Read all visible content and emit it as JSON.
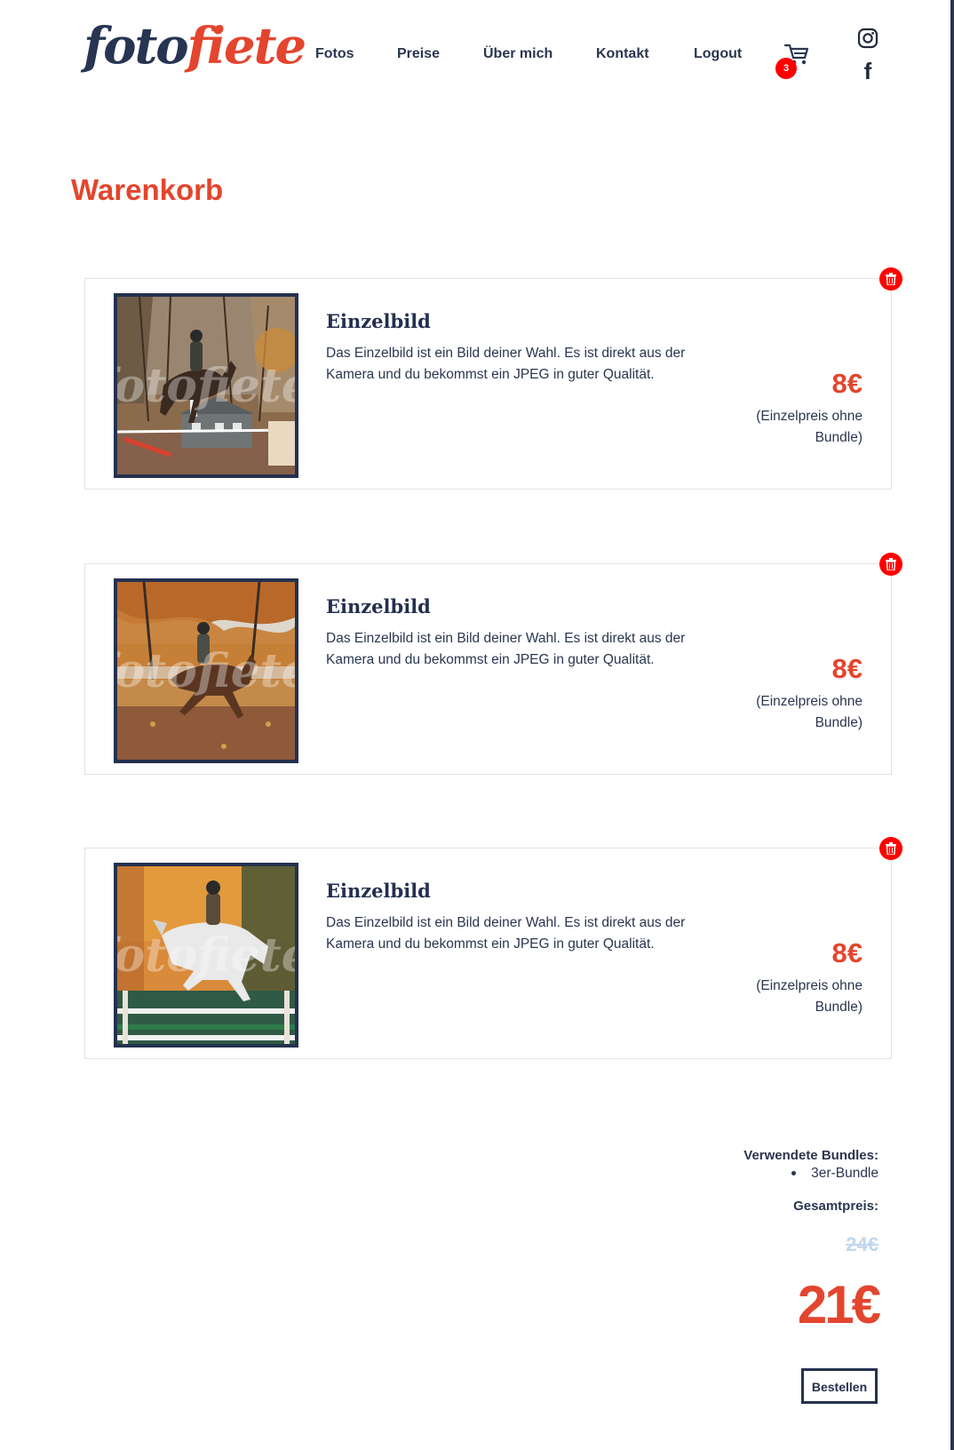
{
  "header": {
    "logo": {
      "part1": "foto",
      "part2": "fiete"
    },
    "nav": [
      "Fotos",
      "Preise",
      "Über mich",
      "Kontakt",
      "Logout"
    ],
    "cart_count": "3",
    "cart_icon": "shopping-cart-icon",
    "social": [
      "instagram-icon",
      "facebook-icon"
    ],
    "facebook_glyph": "f"
  },
  "page_title": "Warenkorb",
  "items": [
    {
      "title": "Einzelbild",
      "description": "Das Einzelbild ist ein Bild deiner Wahl. Es ist direkt aus der Kamera und du bekommst ein JPEG in guter Qualität.",
      "price": "8€",
      "note": "(Einzelpreis ohne Bundle)",
      "image": "horse-jumping-over-miniature-house"
    },
    {
      "title": "Einzelbild",
      "description": "Das Einzelbild ist ein Bild deiner Wahl. Es ist direkt aus der Kamera und du bekommst ein JPEG in guter Qualität.",
      "price": "8€",
      "note": "(Einzelpreis ohne Bundle)",
      "image": "horse-cantering-in-autumn"
    },
    {
      "title": "Einzelbild",
      "description": "Das Einzelbild ist ein Bild deiner Wahl. Es ist direkt aus der Kamera und du bekommst ein JPEG in guter Qualität.",
      "price": "8€",
      "note": "(Einzelpreis ohne Bundle)",
      "image": "white-horse-jumping-fence"
    }
  ],
  "summary": {
    "bundles_label": "Verwendete Bundles:",
    "bundles": [
      "3er-Bundle"
    ],
    "total_label": "Gesamtpreis:",
    "old_price": "24€",
    "new_price": "21€",
    "order_button": "Bestellen"
  },
  "watermark": "fotofiete",
  "colors": {
    "accent": "#e3452e",
    "navy": "#24314f",
    "delete": "#ff0000",
    "old_price": "#bfd7ec"
  }
}
